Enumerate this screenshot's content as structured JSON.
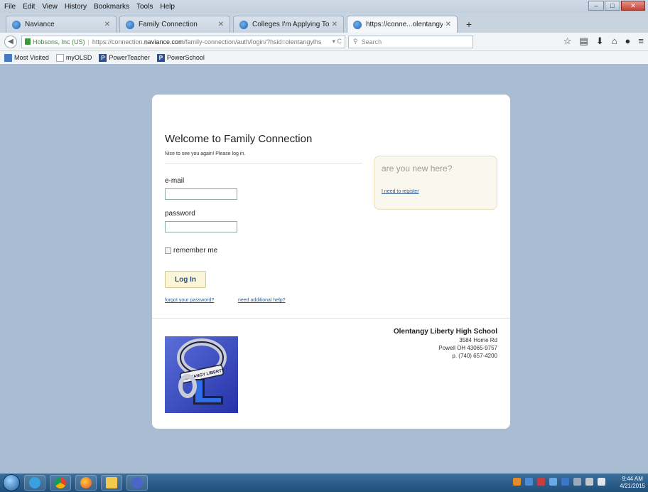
{
  "menubar": [
    "File",
    "Edit",
    "View",
    "History",
    "Bookmarks",
    "Tools",
    "Help"
  ],
  "tabs": [
    {
      "label": "Naviance",
      "active": false
    },
    {
      "label": "Family Connection",
      "active": false
    },
    {
      "label": "Colleges I'm Applying To",
      "active": false
    },
    {
      "label": "https://conne...olentangylhs",
      "active": true
    }
  ],
  "address": {
    "org": "Hobsons, Inc (US)",
    "url_prefix": "https://connection.",
    "url_domain": "naviance.com",
    "url_path": "/family-connection/auth/login/?hsid=olentangylhs",
    "search_placeholder": "Search"
  },
  "bookmarks": [
    {
      "label": "Most Visited",
      "icon": "bookmark-icon"
    },
    {
      "label": "myOLSD",
      "icon": "blank-page-icon"
    },
    {
      "label": "PowerTeacher",
      "icon": "powerschool-icon"
    },
    {
      "label": "PowerSchool",
      "icon": "powerschool-icon"
    }
  ],
  "login": {
    "title": "Welcome to Family Connection",
    "subtitle": "Nice to see you again! Please log in.",
    "email_label": "e-mail",
    "password_label": "password",
    "remember_label": "remember me",
    "button": "Log In",
    "forgot_link": "forgot your password?",
    "help_link": "need additional help?"
  },
  "newuser": {
    "title": "are you new here?",
    "link": "I need to register"
  },
  "school": {
    "name": "Olentangy Liberty High School",
    "street": "3584 Home Rd",
    "city": "Powell OH 43065-9757",
    "phone": "p. (740) 657-4200",
    "logo_text": "OLENTANGY LIBERTY"
  },
  "taskbar": {
    "time": "9:44 AM",
    "date": "4/21/2015"
  },
  "colors": {
    "page_bg": "#a9bcd1",
    "button_bg": "#fbf6d9",
    "link": "#2d5a94"
  }
}
